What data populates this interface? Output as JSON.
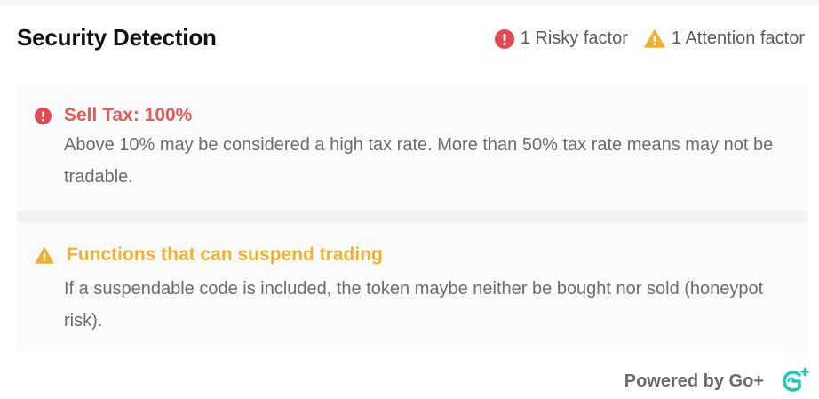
{
  "header": {
    "title": "Security Detection",
    "risky_count": "1 Risky factor",
    "attention_count": "1 Attention factor"
  },
  "risks": [
    {
      "level": "risky",
      "icon": "exclamation-circle-icon",
      "color": "#e55a56",
      "title": "Sell Tax: 100%",
      "description": "Above 10% may be considered a high tax rate. More than 50% tax rate means may not be tradable."
    },
    {
      "level": "attention",
      "icon": "warning-triangle-icon",
      "color": "#f0b030",
      "title": "Functions that can suspend trading",
      "description": "If a suspendable code is included, the token maybe neither be bought nor sold (honeypot risk)."
    }
  ],
  "footer": {
    "powered_by": "Powered by Go+",
    "logo_icon": "goplus-logo-icon"
  }
}
